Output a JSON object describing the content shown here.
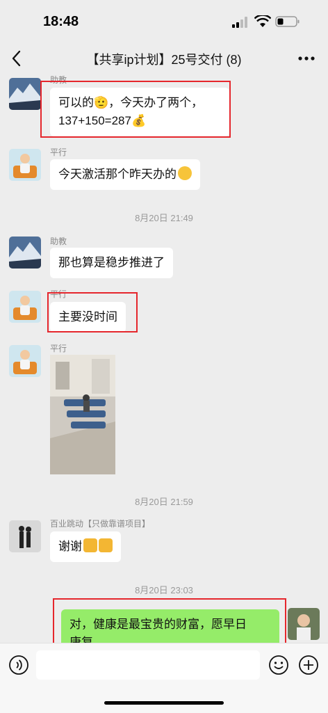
{
  "status": {
    "time": "18:48"
  },
  "nav": {
    "title": "【共享ip计划】25号交付 (8)"
  },
  "messages": [
    {
      "sender": "助教",
      "text": "可以的🫡，今天办了两个，",
      "text2": "137+150=287💰"
    },
    {
      "sender": "平行",
      "text": "今天激活那个昨天办的"
    },
    {
      "time": "8月20日 21:49"
    },
    {
      "sender": "助教",
      "text": "那也算是稳步推进了"
    },
    {
      "sender": "平行",
      "text": "主要没时间"
    },
    {
      "sender": "平行",
      "image": "photo-waiting-room"
    },
    {
      "time": "8月20日 21:59"
    },
    {
      "sender": "百业跳动【只做靠谱项目】",
      "text": "谢谢"
    },
    {
      "time": "8月20日 23:03"
    },
    {
      "sender": "",
      "text": "对，健康是最宝贵的财富，愿早日",
      "text2": "康复"
    }
  ],
  "colors": {
    "bg": "#ededed",
    "bubble_self": "#95ec69",
    "highlight": "#e5262c"
  },
  "icons": [
    "back-icon",
    "more-icon",
    "voice-icon",
    "emoji-icon",
    "plus-icon"
  ]
}
